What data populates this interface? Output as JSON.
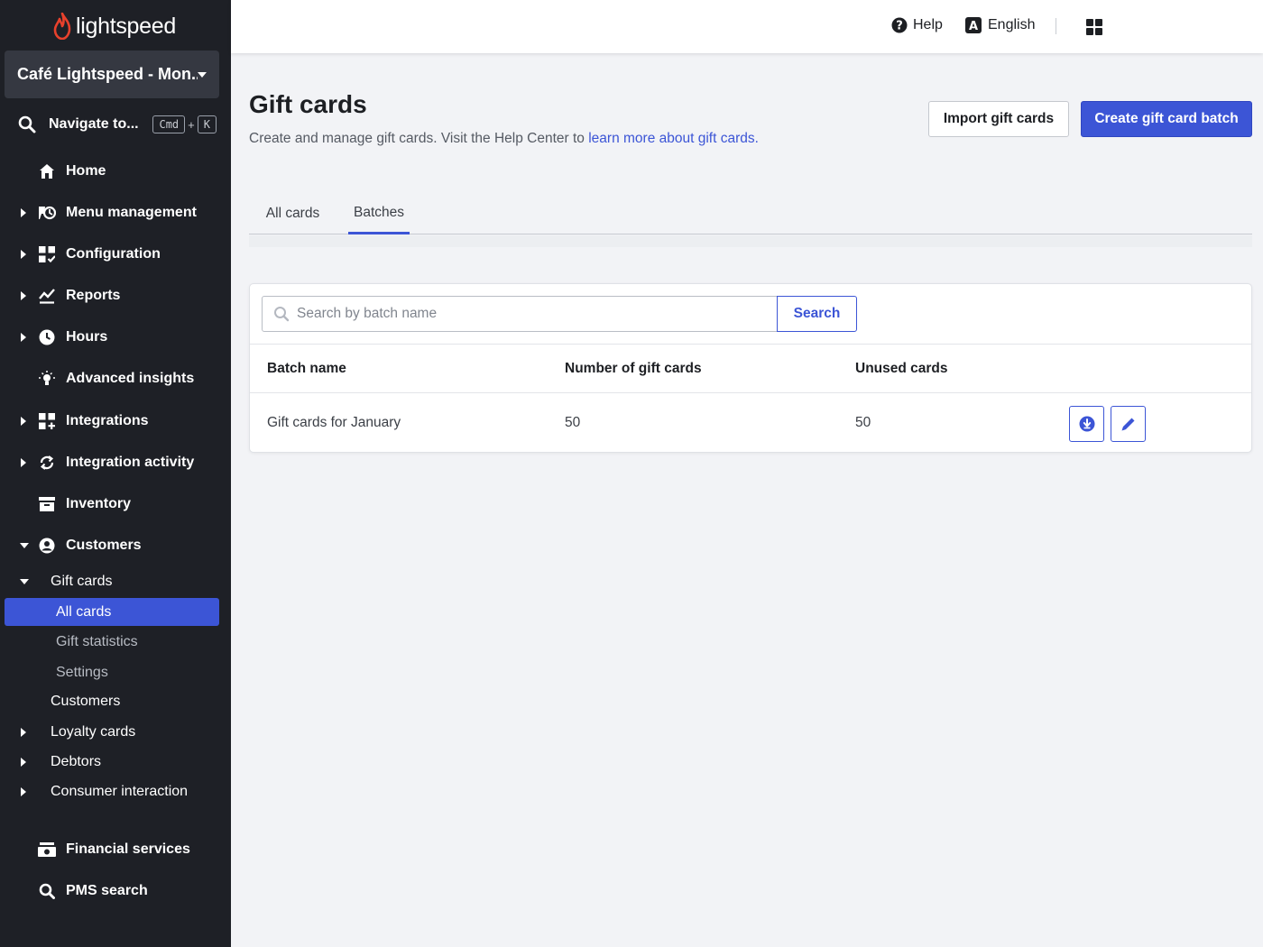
{
  "sidebar": {
    "logo_text": "lightspeed",
    "venue_name": "Café Lightspeed - Mon...",
    "navigate": {
      "label": "Navigate to...",
      "key1": "Cmd",
      "plus": "+",
      "key2": "K"
    },
    "items": [
      {
        "label": "Home",
        "icon": "home-icon"
      },
      {
        "label": "Menu management",
        "icon": "menu-management-icon"
      },
      {
        "label": "Configuration",
        "icon": "configuration-icon"
      },
      {
        "label": "Reports",
        "icon": "reports-icon"
      },
      {
        "label": "Hours",
        "icon": "clock-icon"
      },
      {
        "label": "Advanced insights",
        "icon": "lightbulb-icon"
      },
      {
        "label": "Integrations",
        "icon": "integrations-icon"
      },
      {
        "label": "Integration activity",
        "icon": "sync-icon"
      },
      {
        "label": "Inventory",
        "icon": "inventory-icon"
      },
      {
        "label": "Customers",
        "icon": "customer-icon"
      }
    ],
    "customers_sub": {
      "gift_cards": "Gift cards",
      "all_cards": "All cards",
      "gift_statistics": "Gift statistics",
      "settings": "Settings",
      "customers": "Customers",
      "loyalty_cards": "Loyalty cards",
      "debtors": "Debtors",
      "consumer_interaction": "Consumer interaction"
    },
    "bottom_items": [
      {
        "label": "Financial services",
        "icon": "financial-services-icon"
      },
      {
        "label": "PMS search",
        "icon": "search-icon"
      }
    ]
  },
  "topbar": {
    "help": "Help",
    "language": "English"
  },
  "page": {
    "title": "Gift cards",
    "description": "Create and manage gift cards. Visit the Help Center to ",
    "description_link": "learn more about gift cards.",
    "import_button": "Import gift cards",
    "create_button": "Create gift card batch"
  },
  "tabs": [
    {
      "label": "All cards",
      "active": false
    },
    {
      "label": "Batches",
      "active": true
    }
  ],
  "search": {
    "placeholder": "Search by batch name",
    "button": "Search"
  },
  "table": {
    "columns": [
      "Batch name",
      "Number of gift cards",
      "Unused cards"
    ],
    "rows": [
      {
        "batch_name": "Gift cards for January",
        "number": "50",
        "unused": "50"
      }
    ]
  },
  "colors": {
    "accent": "#3c55d6",
    "sidebar_bg": "#1e2026",
    "brand_red": "#e8412c"
  }
}
